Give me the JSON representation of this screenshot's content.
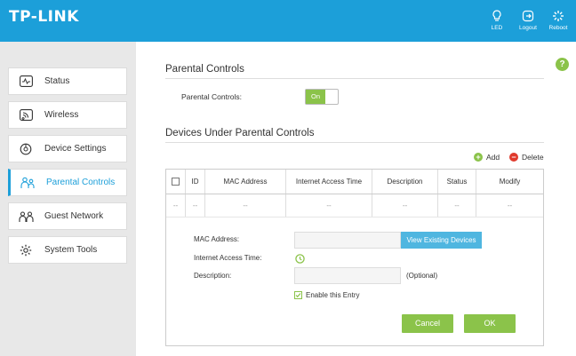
{
  "header": {
    "logo": "TP-LINK",
    "buttons": [
      {
        "label": "LED",
        "icon": "bulb-icon"
      },
      {
        "label": "Logout",
        "icon": "logout-icon"
      },
      {
        "label": "Reboot",
        "icon": "reboot-icon"
      }
    ]
  },
  "sidebar": {
    "items": [
      {
        "label": "Status",
        "icon": "status-icon",
        "active": false
      },
      {
        "label": "Wireless",
        "icon": "wireless-icon",
        "active": false
      },
      {
        "label": "Device Settings",
        "icon": "device-settings-icon",
        "active": false
      },
      {
        "label": "Parental Controls",
        "icon": "parental-controls-icon",
        "active": true
      },
      {
        "label": "Guest Network",
        "icon": "guest-network-icon",
        "active": false
      },
      {
        "label": "System Tools",
        "icon": "system-tools-icon",
        "active": false
      }
    ]
  },
  "help": "?",
  "main": {
    "section1_title": "Parental Controls",
    "pc_label": "Parental Controls:",
    "toggle_on": "On",
    "section2_title": "Devices Under Parental Controls",
    "add_label": "Add",
    "delete_label": "Delete",
    "table": {
      "headers": [
        "ID",
        "MAC Address",
        "Internet Access Time",
        "Description",
        "Status",
        "Modify"
      ],
      "row": [
        "--",
        "--",
        "--",
        "--",
        "--",
        "--",
        "--"
      ]
    },
    "form": {
      "mac_label": "MAC Address:",
      "view_devices": "View Existing Devices",
      "time_label": "Internet Access Time:",
      "desc_label": "Description:",
      "optional": "(Optional)",
      "enable_label": "Enable this Entry",
      "cancel": "Cancel",
      "ok": "OK"
    }
  },
  "colors": {
    "brand": "#1c9fd9",
    "green": "#8bc34a",
    "delete": "#e03a2d",
    "button_blue": "#4fb6e0"
  }
}
